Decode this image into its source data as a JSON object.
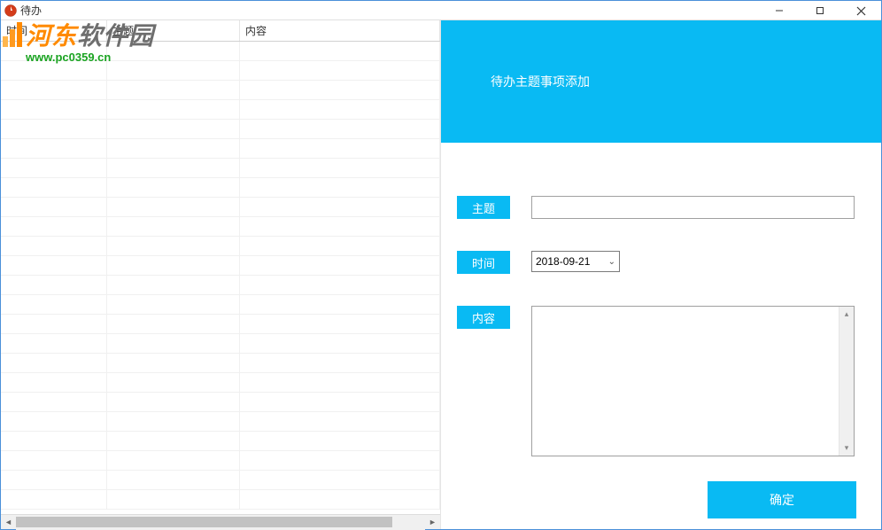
{
  "window": {
    "title": "待办"
  },
  "watermark": {
    "text_main_a": "河东",
    "text_main_b": "软件园",
    "url": "www.pc0359.cn"
  },
  "table": {
    "columns": {
      "time": "时间",
      "subject": "主题",
      "content": "内容"
    }
  },
  "form": {
    "header_title": "待办主题事项添加",
    "subject_label": "主题",
    "subject_value": "",
    "time_label": "时间",
    "date_value": "2018-09-21",
    "content_label": "内容",
    "content_value": "",
    "confirm_label": "确定"
  }
}
